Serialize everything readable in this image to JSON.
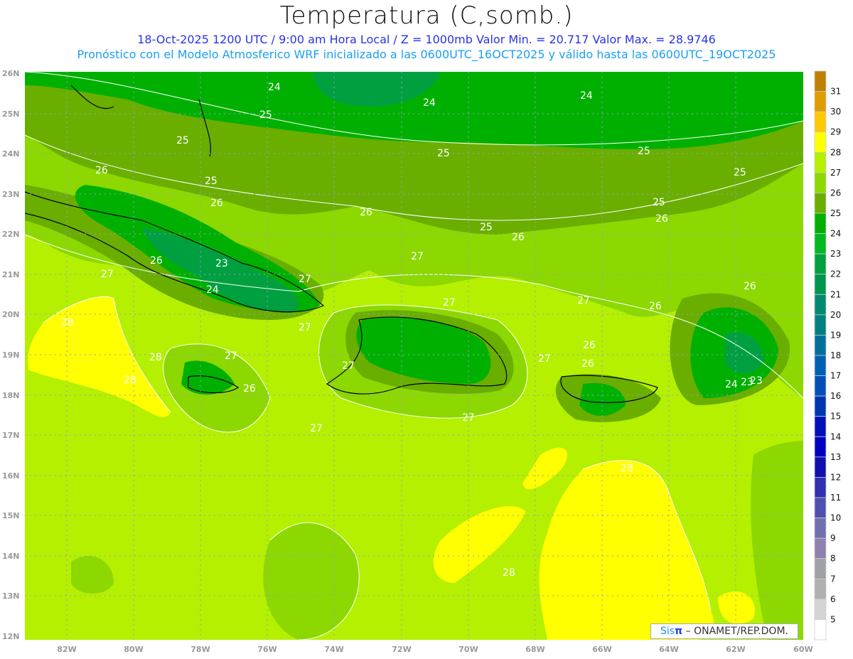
{
  "header": {
    "title": "Temperatura (C,somb.)",
    "line1": "18-Oct-2025  1200 UTC / 9:00 am Hora Local / Z = 1000mb    Valor Min. = 20.717  Valor Max. = 28.9746",
    "line2": "Pronóstico con el Modelo Atmosferico WRF inicializado a las 0600UTC_16OCT2025 y válido hasta las  0600UTC_19OCT2025"
  },
  "axes": {
    "lat_labels": [
      "26N",
      "25N",
      "24N",
      "23N",
      "22N",
      "21N",
      "20N",
      "19N",
      "18N",
      "17N",
      "16N",
      "15N",
      "14N",
      "13N",
      "12N"
    ],
    "lon_labels": [
      "82W",
      "80W",
      "78W",
      "76W",
      "74W",
      "72W",
      "70W",
      "68W",
      "66W",
      "64W",
      "62W",
      "60W"
    ]
  },
  "colorbar": {
    "labels": [
      "31",
      "30",
      "29",
      "28",
      "27",
      "26",
      "25",
      "24",
      "23",
      "22",
      "21",
      "20",
      "19",
      "18",
      "17",
      "16",
      "15",
      "14",
      "13",
      "12",
      "11",
      "10",
      "9",
      "8",
      "7",
      "6",
      "5"
    ],
    "colors": [
      "#c08000",
      "#e09c00",
      "#ffc800",
      "#ffff00",
      "#b4f000",
      "#8cd800",
      "#6aae00",
      "#00b000",
      "#00b820",
      "#00a040",
      "#009650",
      "#008a70",
      "#008080",
      "#00709a",
      "#0060b4",
      "#0050b8",
      "#0034b0",
      "#0010b8",
      "#0000c0",
      "#1010b0",
      "#3030b0",
      "#5050b0",
      "#7070b0",
      "#9080b0",
      "#a0a0a8",
      "#b0b0b0",
      "#d4d4d4",
      "#ffffff"
    ]
  },
  "contour_labels": [
    "24",
    "24",
    "24",
    "25",
    "25",
    "25",
    "25",
    "25",
    "25",
    "25",
    "25",
    "26",
    "26",
    "26",
    "26",
    "26",
    "26",
    "26",
    "26",
    "26",
    "26",
    "26",
    "27",
    "27",
    "27",
    "27",
    "27",
    "27",
    "27",
    "27",
    "27",
    "27",
    "27",
    "28",
    "28",
    "28",
    "28",
    "28",
    "23",
    "23",
    "23",
    "24",
    "24"
  ],
  "credit": {
    "sis": "Sis",
    "pi": "π",
    "rest": "– ONAMET/REP.DOM."
  }
}
